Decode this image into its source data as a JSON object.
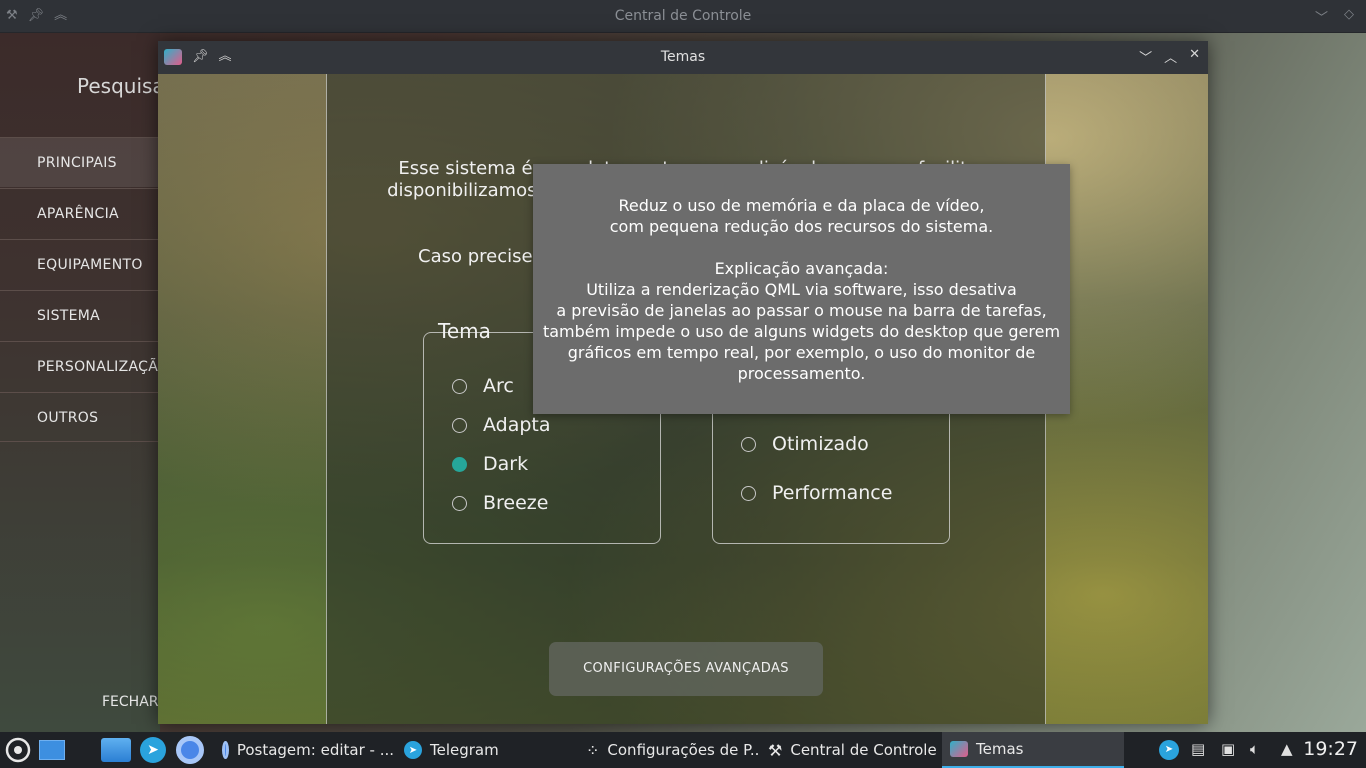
{
  "back_window": {
    "title": "Central de Controle",
    "search_label": "Pesquisa",
    "sidebar": {
      "items": [
        {
          "label": "PRINCIPAIS"
        },
        {
          "label": "APARÊNCIA"
        },
        {
          "label": "EQUIPAMENTO"
        },
        {
          "label": "SISTEMA"
        },
        {
          "label": "PERSONALIZAÇÃO"
        },
        {
          "label": "OUTROS"
        }
      ],
      "close_label": "FECHAR"
    }
  },
  "window": {
    "title": "Temas",
    "intro_text": "Esse sistema é completamente personalizável, mas para facilitar disponibilizamos quatro opções de temas e também três opções de",
    "intro_text_2": "Caso precise avançadas, o",
    "theme_group": {
      "legend": "Tema",
      "options": [
        {
          "label": "Arc",
          "checked": false
        },
        {
          "label": "Adapta",
          "checked": false
        },
        {
          "label": "Dark",
          "checked": true
        },
        {
          "label": "Breeze",
          "checked": false
        }
      ]
    },
    "perf_group": {
      "options": [
        {
          "label": "Otimizado",
          "checked": false
        },
        {
          "label": "Performance",
          "checked": false
        }
      ]
    },
    "advanced_button": "CONFIGURAÇÕES AVANÇADAS",
    "tooltip": {
      "line1": "Reduz o uso de memória e da placa de vídeo,",
      "line2": "com pequena redução dos recursos do sistema.",
      "heading": "Explicação avançada:",
      "line3": "Utiliza a renderização QML via software, isso desativa",
      "line4": "a previsão de janelas ao passar o mouse na barra de tarefas,",
      "line5": "também impede o uso de alguns widgets do desktop que gerem",
      "line6": "gráficos em tempo real, por exemplo, o uso do monitor de",
      "line7": "processamento."
    },
    "accent_color": "#26a69a"
  },
  "taskbar": {
    "tasks": [
      {
        "label": "Postagem: editar - ...",
        "icon": "chrome-icon"
      },
      {
        "label": "Telegram",
        "icon": "telegram-icon"
      },
      {
        "label": "Configurações de P...",
        "icon": "settings-icon"
      },
      {
        "label": "Central de Controle",
        "icon": "tools-icon"
      },
      {
        "label": "Temas",
        "icon": "app-logo-icon"
      }
    ],
    "clock": "19:27"
  }
}
